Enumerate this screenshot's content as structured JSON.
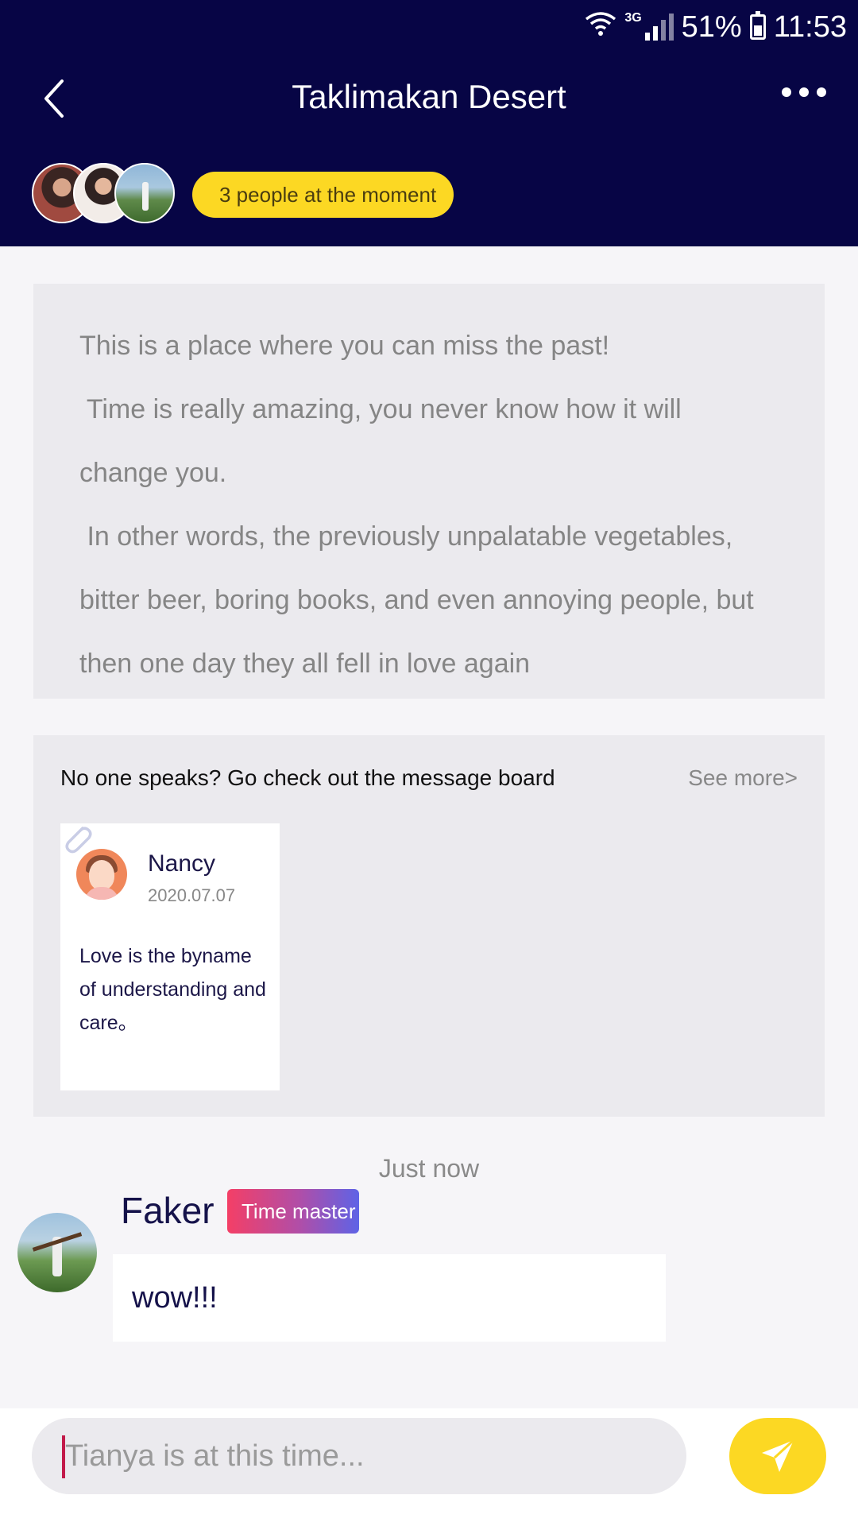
{
  "status_bar": {
    "network": "3G",
    "battery": "51%",
    "time": "11:53"
  },
  "header": {
    "title": "Taklimakan Desert",
    "people_pill": "3 people at the moment"
  },
  "intro": {
    "lines": [
      "This is a place where you can miss the past!",
      " Time is really amazing, you never know how it will",
      "change you.",
      " In other words, the previously unpalatable vegetables,",
      "bitter beer, boring books, and even annoying people, but",
      "then one day they all fell in love again"
    ]
  },
  "message_board": {
    "title": "No one speaks? Go check out the message board",
    "see_more": "See more>",
    "note": {
      "name": "Nancy",
      "date": "2020.07.07",
      "text": "Love is the byname of understanding and care。"
    }
  },
  "chat": {
    "time_label": "Just now",
    "message": {
      "user": "Faker",
      "badge": "Time master",
      "text": "wow!!!"
    }
  },
  "composer": {
    "placeholder": "Tianya is at this time..."
  },
  "colors": {
    "header_bg": "#070545",
    "accent_yellow": "#fcd823",
    "panel_bg": "#ebeaee",
    "badge_gradient_start": "#f43f66",
    "badge_gradient_end": "#5e63e6"
  },
  "icons": {
    "back": "chevron-left-icon",
    "more": "more-dots-icon",
    "clip": "paperclip-icon",
    "send": "send-icon"
  }
}
